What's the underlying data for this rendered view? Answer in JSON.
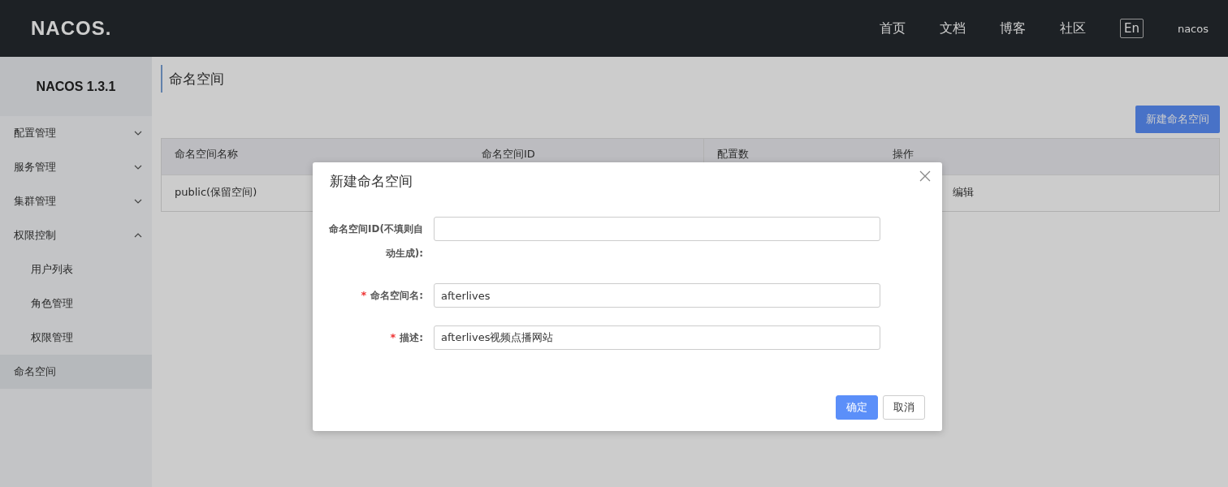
{
  "header": {
    "logo": "NACOS.",
    "nav": [
      "首页",
      "文档",
      "博客",
      "社区"
    ],
    "language": "En",
    "user": "nacos"
  },
  "sidebar": {
    "title": "NACOS 1.3.1",
    "items": [
      {
        "label": "配置管理",
        "selected": false,
        "expanded": false
      },
      {
        "label": "服务管理",
        "selected": false,
        "expanded": false
      },
      {
        "label": "集群管理",
        "selected": false,
        "expanded": false
      },
      {
        "label": "权限控制",
        "selected": false,
        "expanded": true,
        "children": [
          {
            "label": "用户列表",
            "selected": false
          },
          {
            "label": "角色管理",
            "selected": false
          },
          {
            "label": "权限管理",
            "selected": false
          }
        ]
      },
      {
        "label": "命名空间",
        "selected": true
      }
    ]
  },
  "page": {
    "title": "命名空间",
    "new_button": "新建命名空间",
    "table": {
      "columns": [
        "命名空间名称",
        "命名空间ID",
        "配置数",
        "操作"
      ],
      "rows": [
        {
          "name": "public(保留空间)",
          "action": "编辑"
        }
      ]
    }
  },
  "dialog": {
    "title": "新建命名空间",
    "fields": [
      {
        "label": "命名空间ID(不填则自动生成):"
      },
      {
        "required_mark": "*",
        "label": "命名空间名:",
        "value": "afterlives"
      },
      {
        "required_mark": "*",
        "label": "描述:",
        "value": "afterlives视频点播网站"
      }
    ],
    "buttons": [
      {
        "label": "确定",
        "primary": true
      },
      {
        "label": "取消",
        "primary": false
      }
    ]
  }
}
